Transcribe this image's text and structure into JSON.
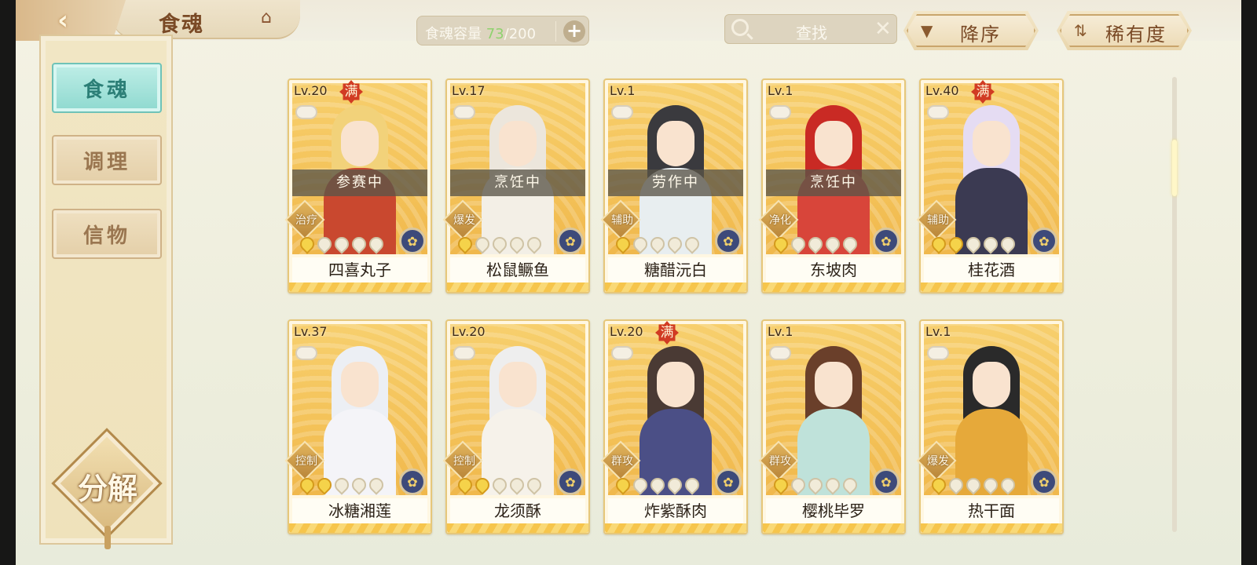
{
  "header": {
    "back_icon": "chevron-left-icon",
    "title": "食魂",
    "pavilion_icon": "pavilion-icon",
    "capacity_label": "食魂容量",
    "capacity_current": "73",
    "capacity_total": "/200",
    "add_label": "+",
    "search_placeholder": "查找",
    "search_clear": "✕",
    "sort_label": "降序",
    "sort_icon": "▼",
    "rarity_label": "稀有度",
    "rarity_icon": "⇅"
  },
  "sidebar": {
    "tabs": [
      {
        "label": "食魂",
        "active": true
      },
      {
        "label": "调理",
        "active": false
      },
      {
        "label": "信物",
        "active": false
      }
    ],
    "decompose_label": "分解"
  },
  "colors": {
    "accent_teal": "#8ed9cf",
    "card_gold": "#f4c35a",
    "max_badge_red": "#d13b23"
  },
  "cards": [
    {
      "level": "Lv.20",
      "max": "满",
      "status": "参赛中",
      "role": "治疗",
      "stars": 1,
      "name": "四喜丸子",
      "hair": "#f2d27a",
      "body": "#c9482f",
      "element_icon": "flower-icon"
    },
    {
      "level": "Lv.17",
      "max": "",
      "status": "烹饪中",
      "role": "爆发",
      "stars": 1,
      "name": "松鼠鳜鱼",
      "hair": "#ece6dc",
      "body": "#f3efe6",
      "element_icon": "flower-icon"
    },
    {
      "level": "Lv.1",
      "max": "",
      "status": "劳作中",
      "role": "辅助",
      "stars": 1,
      "name": "糖醋沅白",
      "hair": "#3a3a3e",
      "body": "#e8eef0",
      "element_icon": "flame-icon"
    },
    {
      "level": "Lv.1",
      "max": "",
      "status": "烹饪中",
      "role": "净化",
      "stars": 1,
      "name": "东坡肉",
      "hair": "#c92a24",
      "body": "#d8453a",
      "element_icon": "flame-icon"
    },
    {
      "level": "Lv.40",
      "max": "满",
      "status": "",
      "role": "辅助",
      "stars": 2,
      "name": "桂花酒",
      "hair": "#e5dcf3",
      "body": "#3b3a52",
      "element_icon": "flower-icon"
    },
    {
      "level": "Lv.37",
      "max": "",
      "status": "",
      "role": "控制",
      "stars": 2,
      "name": "冰糖湘莲",
      "hair": "#eceff4",
      "body": "#f4f4f8",
      "element_icon": "flower-icon"
    },
    {
      "level": "Lv.20",
      "max": "",
      "status": "",
      "role": "控制",
      "stars": 2,
      "name": "龙须酥",
      "hair": "#eeeeee",
      "body": "#f6f2ea",
      "element_icon": "flower-icon"
    },
    {
      "level": "Lv.20",
      "max": "满",
      "status": "",
      "role": "群攻",
      "stars": 1,
      "name": "炸紫酥肉",
      "hair": "#4a3a34",
      "body": "#4b4f86",
      "element_icon": "flame-icon"
    },
    {
      "level": "Lv.1",
      "max": "",
      "status": "",
      "role": "群攻",
      "stars": 1,
      "name": "樱桃毕罗",
      "hair": "#6a3f2a",
      "body": "#bfe2da",
      "element_icon": "flame-icon"
    },
    {
      "level": "Lv.1",
      "max": "",
      "status": "",
      "role": "爆发",
      "stars": 1,
      "name": "热干面",
      "hair": "#2a2a2a",
      "body": "#e6a93a",
      "element_icon": "flower-icon"
    }
  ]
}
